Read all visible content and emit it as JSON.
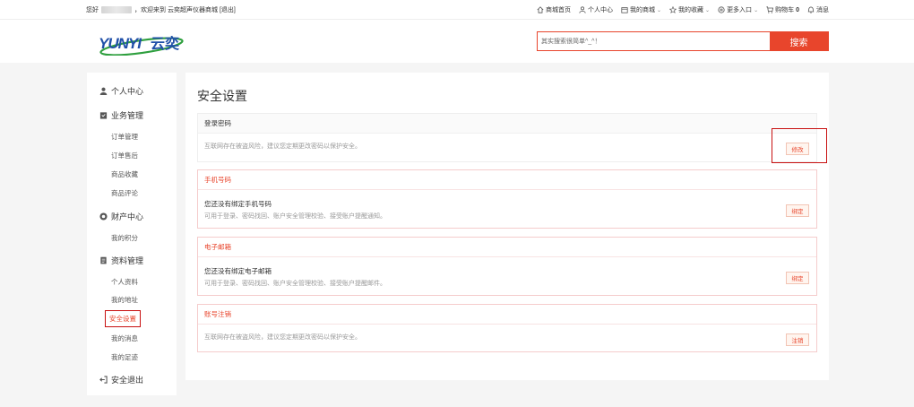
{
  "topbar": {
    "greeting": "您好",
    "welcome": "，欢迎来到 云奕超声仪器商城",
    "logout": "[退出]",
    "nav": [
      {
        "label": "商城首页",
        "icon": "home-icon",
        "caret": false
      },
      {
        "label": "个人中心",
        "icon": "user-icon",
        "caret": false
      },
      {
        "label": "我的商城",
        "icon": "shop-icon",
        "caret": true
      },
      {
        "label": "我的收藏",
        "icon": "star-icon",
        "caret": true
      },
      {
        "label": "更多入口",
        "icon": "menu-icon",
        "caret": true
      },
      {
        "label": "购物车",
        "icon": "cart-icon",
        "caret": false,
        "count": "0"
      },
      {
        "label": "消息",
        "icon": "bell-icon",
        "caret": false
      }
    ]
  },
  "header": {
    "logo_text": "YUNYI云奕",
    "search_placeholder": "其实搜索很简单^_^！",
    "search_button": "搜索"
  },
  "sidebar": {
    "personal_center": "个人中心",
    "business": "业务管理",
    "orders": "订单管理",
    "after_sales": "订单售后",
    "favorites": "商品收藏",
    "reviews": "商品评论",
    "assets": "财产中心",
    "points": "我的积分",
    "profile_mgmt": "资料管理",
    "personal_info": "个人资料",
    "address": "我的地址",
    "security": "安全设置",
    "messages": "我的消息",
    "footprints": "我的足迹",
    "logout": "安全退出"
  },
  "main": {
    "title": "安全设置",
    "password": {
      "header": "登录密码",
      "desc": "互联网存在被盗风险，建议您定期更改密码以保护安全。",
      "button": "修改"
    },
    "phone": {
      "header": "手机号码",
      "title": "您还没有绑定手机号码",
      "desc": "可用于登录、密码找回、账户安全管理校验、接受账户提醒通知。",
      "button": "绑定"
    },
    "email": {
      "header": "电子邮箱",
      "title": "您还没有绑定电子邮箱",
      "desc": "可用于登录、密码找回、账户安全管理校验、接受账户提醒邮件。",
      "button": "绑定"
    },
    "cancel": {
      "header": "账号注销",
      "desc": "互联网存在被盗风险，建议您定期更改密码以保护安全。",
      "button": "注销"
    }
  },
  "colors": {
    "accent": "#e8452c",
    "highlight_box": "#c81010",
    "logo_blue": "#1f4fa8",
    "logo_green": "#2e9f3e"
  }
}
